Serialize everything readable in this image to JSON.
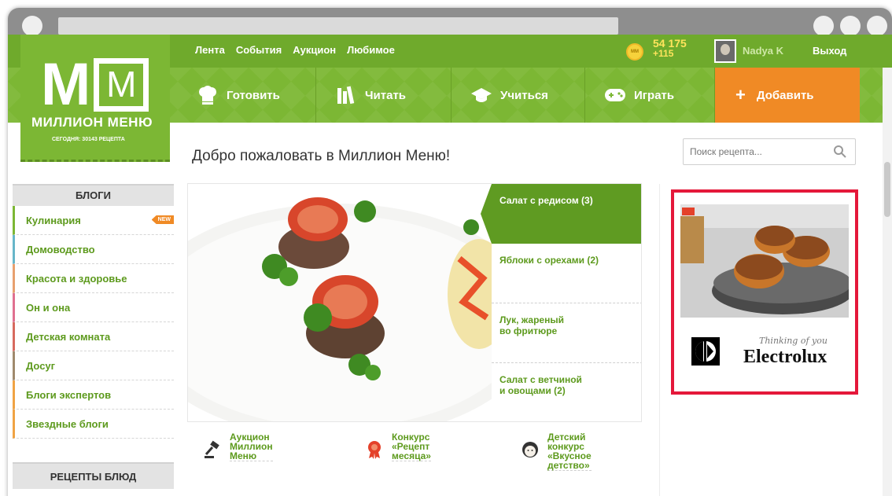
{
  "header": {
    "logo_big": "M",
    "logo_box": "M",
    "logo_name": "МИЛЛИОН МЕНЮ",
    "today": "СЕГОДНЯ: 30143 РЕЦЕПТА",
    "links": [
      "Лента",
      "События",
      "Аукцион",
      "Любимое"
    ],
    "points": "54 175",
    "points_delta": "+115",
    "username": "Nadya K",
    "logout": "Выход"
  },
  "nav": {
    "items": [
      {
        "label": "Готовить",
        "icon": "chef-hat-icon"
      },
      {
        "label": "Читать",
        "icon": "books-icon"
      },
      {
        "label": "Учиться",
        "icon": "graduation-cap-icon"
      },
      {
        "label": "Играть",
        "icon": "gamepad-icon"
      }
    ],
    "add_label": "Добавить"
  },
  "main": {
    "welcome": "Добро пожаловать в Миллион Меню!",
    "search_placeholder": "Поиск рецепта..."
  },
  "sidebar": {
    "blogs_title": "БЛОГИ",
    "items": [
      {
        "label": "Кулинария",
        "color": "#7cb734",
        "badge": "NEW"
      },
      {
        "label": "Домоводство",
        "color": "#67b6c9"
      },
      {
        "label": "Красота и здоровье",
        "color": "#e8a06f"
      },
      {
        "label": "Он и она",
        "color": "#e07090"
      },
      {
        "label": "Детская комната",
        "color": "#d76a5f"
      },
      {
        "label": "Досуг",
        "color": "#a08a6d"
      },
      {
        "label": "Блоги экспертов",
        "color": "#f0a344"
      },
      {
        "label": "Звездные блоги",
        "color": "#f0a344"
      }
    ],
    "recipes_title": "РЕЦЕПТЫ БЛЮД"
  },
  "slider": {
    "tabs": [
      {
        "label": "Салат с редисом (3)",
        "active": true
      },
      {
        "label": "Яблоки с орехами (2)",
        "active": false
      },
      {
        "label": "Лук, жареный\nво фритюре",
        "active": false
      },
      {
        "label": "Салат с ветчиной\nи овощами (2)",
        "active": false
      }
    ]
  },
  "promos": [
    {
      "label": "Аукцион\nМиллион\nМеню",
      "icon": "gavel-icon"
    },
    {
      "label": "Конкурс\n«Рецепт\nмесяца»",
      "icon": "award-icon"
    },
    {
      "label": "Детский\nконкурс\n«Вкусное\nдетство»",
      "icon": "child-icon"
    }
  ],
  "ad": {
    "tagline": "Thinking of you",
    "brand": "Electrolux"
  },
  "colors": {
    "brand_green": "#7cb734",
    "accent_orange": "#f08a25",
    "ad_border": "#e4183a"
  }
}
